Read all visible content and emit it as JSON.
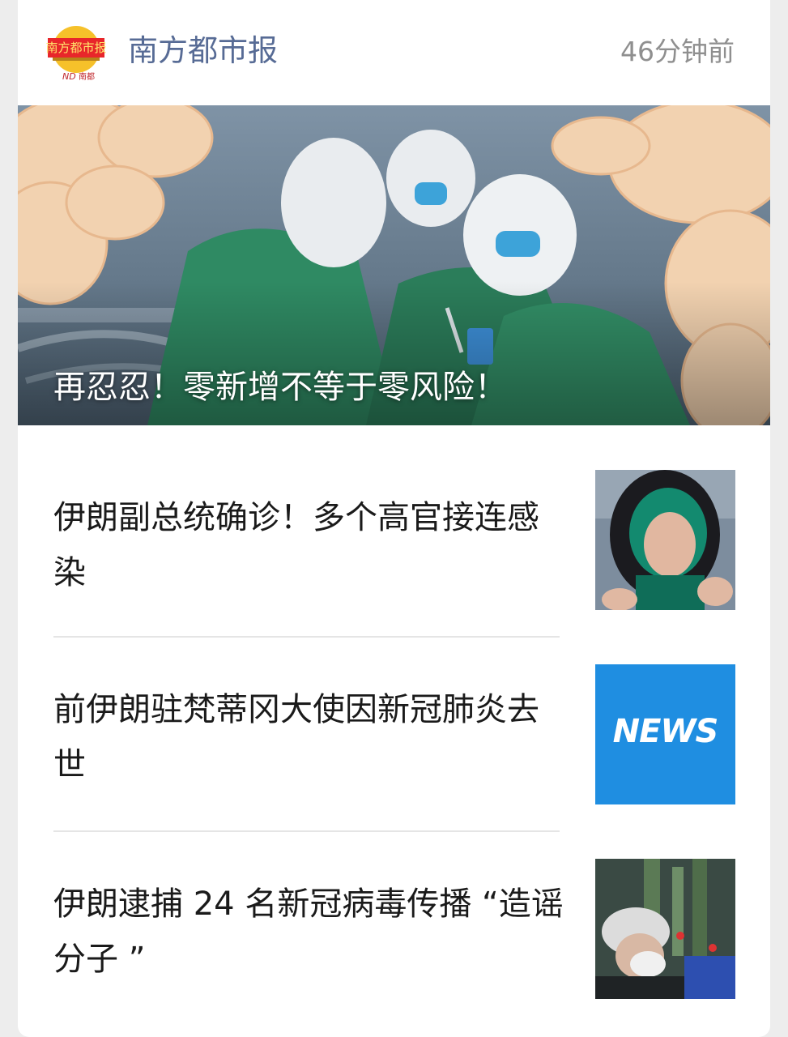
{
  "header": {
    "account_name": "南方都市报",
    "timestamp": "46分钟前",
    "logo_icon": "nandu-newspaper-logo"
  },
  "hero": {
    "title": "再忍忍！零新增不等于零风险！"
  },
  "articles": [
    {
      "title": "伊朗副总统确诊！多个高官接连感染",
      "thumbnail": "woman-in-headscarf-photo"
    },
    {
      "title": "前伊朗驻梵蒂冈大使因新冠肺炎去世",
      "thumbnail": "news-placeholder",
      "thumbnail_text": "NEWS"
    },
    {
      "title": "伊朗逮捕 24 名新冠病毒传播 “造谣分子 ”",
      "thumbnail": "worker-in-mask-photo"
    }
  ],
  "colors": {
    "account_name": "#576b95",
    "timestamp": "#8f8f8f",
    "news_blue": "#1f8ee1"
  }
}
